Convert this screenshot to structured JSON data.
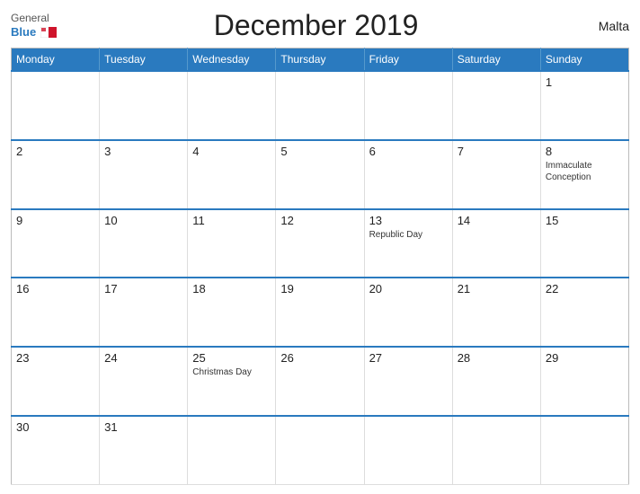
{
  "header": {
    "logo_general": "General",
    "logo_blue": "Blue",
    "title": "December 2019",
    "country": "Malta"
  },
  "weekdays": [
    "Monday",
    "Tuesday",
    "Wednesday",
    "Thursday",
    "Friday",
    "Saturday",
    "Sunday"
  ],
  "weeks": [
    [
      {
        "date": "",
        "holiday": ""
      },
      {
        "date": "",
        "holiday": ""
      },
      {
        "date": "",
        "holiday": ""
      },
      {
        "date": "",
        "holiday": ""
      },
      {
        "date": "",
        "holiday": ""
      },
      {
        "date": "",
        "holiday": ""
      },
      {
        "date": "1",
        "holiday": ""
      }
    ],
    [
      {
        "date": "2",
        "holiday": ""
      },
      {
        "date": "3",
        "holiday": ""
      },
      {
        "date": "4",
        "holiday": ""
      },
      {
        "date": "5",
        "holiday": ""
      },
      {
        "date": "6",
        "holiday": ""
      },
      {
        "date": "7",
        "holiday": ""
      },
      {
        "date": "8",
        "holiday": "Immaculate Conception"
      }
    ],
    [
      {
        "date": "9",
        "holiday": ""
      },
      {
        "date": "10",
        "holiday": ""
      },
      {
        "date": "11",
        "holiday": ""
      },
      {
        "date": "12",
        "holiday": ""
      },
      {
        "date": "13",
        "holiday": "Republic Day"
      },
      {
        "date": "14",
        "holiday": ""
      },
      {
        "date": "15",
        "holiday": ""
      }
    ],
    [
      {
        "date": "16",
        "holiday": ""
      },
      {
        "date": "17",
        "holiday": ""
      },
      {
        "date": "18",
        "holiday": ""
      },
      {
        "date": "19",
        "holiday": ""
      },
      {
        "date": "20",
        "holiday": ""
      },
      {
        "date": "21",
        "holiday": ""
      },
      {
        "date": "22",
        "holiday": ""
      }
    ],
    [
      {
        "date": "23",
        "holiday": ""
      },
      {
        "date": "24",
        "holiday": ""
      },
      {
        "date": "25",
        "holiday": "Christmas Day"
      },
      {
        "date": "26",
        "holiday": ""
      },
      {
        "date": "27",
        "holiday": ""
      },
      {
        "date": "28",
        "holiday": ""
      },
      {
        "date": "29",
        "holiday": ""
      }
    ],
    [
      {
        "date": "30",
        "holiday": ""
      },
      {
        "date": "31",
        "holiday": ""
      },
      {
        "date": "",
        "holiday": ""
      },
      {
        "date": "",
        "holiday": ""
      },
      {
        "date": "",
        "holiday": ""
      },
      {
        "date": "",
        "holiday": ""
      },
      {
        "date": "",
        "holiday": ""
      }
    ]
  ]
}
